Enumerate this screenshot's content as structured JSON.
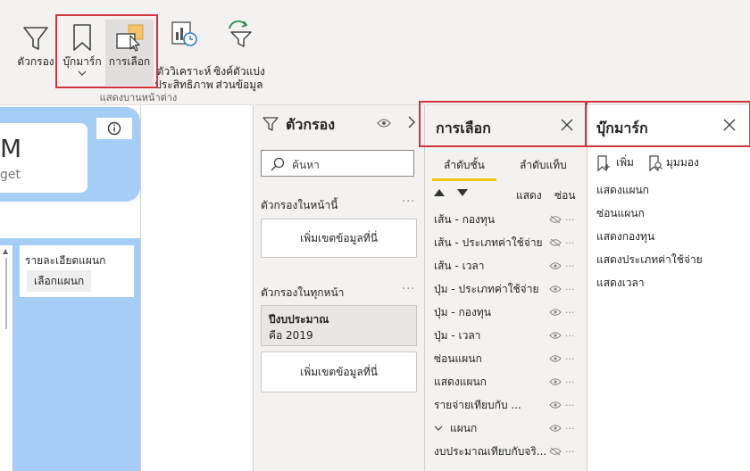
{
  "ribbon": {
    "buttons": [
      {
        "label": "ตัวกรอง",
        "icon": "filter-icon"
      },
      {
        "label": "บุ๊กมาร์ก",
        "icon": "bookmark-icon",
        "dropdown": "chevron-down-icon"
      },
      {
        "label": "การเลือก",
        "icon": "selection-icon"
      },
      {
        "label": "ตัววิเคราะห์\nประสิทธิภาพ",
        "icon": "performance-analyzer-icon"
      },
      {
        "label": "ซิงค์ตัวแบ่ง\nส่วนข้อมูล",
        "icon": "sync-slicers-icon"
      }
    ],
    "group_label": "แสดงบานหน้าต่าง",
    "highlight_color": "#d1343d"
  },
  "canvas": {
    "card_letter": "M",
    "card_subtext": "get",
    "info_icon": "info-icon",
    "detail_label": "รายละเอียดแผนก",
    "detail_button": "เลือกแผนก",
    "accent_color": "#a5cdf6"
  },
  "filters": {
    "title": "ตัวกรอง",
    "search_placeholder": "ค้นหา",
    "page_section": "ตัวกรองในหน้านี้",
    "page_well": "เพิ่มเขตข้อมูลที่นี่",
    "all_section": "ตัวกรองในทุกหน้า",
    "card_title": "ปีงบประมาณ",
    "card_value": "คือ 2019",
    "all_well": "เพิ่มเขตข้อมูลที่นี่"
  },
  "selection": {
    "title": "การเลือก",
    "tabs": [
      "ลำดับชั้น",
      "ลำดับแท็บ"
    ],
    "show_label": "แสดง",
    "hide_label": "ซ่อน",
    "items": [
      {
        "label": "เส้น - กองทุน",
        "visible": false
      },
      {
        "label": "เส้น - ประเภทค่าใช้จ่าย",
        "visible": false
      },
      {
        "label": "เส้น - เวลา",
        "visible": true
      },
      {
        "label": "ปุ่ม - ประเภทค่าใช้จ่าย",
        "visible": true
      },
      {
        "label": "ปุ่ม - กองทุน",
        "visible": true
      },
      {
        "label": "ปุ่ม - เวลา",
        "visible": true
      },
      {
        "label": "ซ่อนแผนก",
        "visible": true
      },
      {
        "label": "แสดงแผนก",
        "visible": true
      },
      {
        "label": "รายจ่ายเทียบกับ ...",
        "visible": true
      },
      {
        "label": "แผนก",
        "visible": true,
        "group": true
      },
      {
        "label": "งบประมาณเทียบกับจริ...",
        "visible": false
      }
    ],
    "accent_color": "#f2c811"
  },
  "bookmarks": {
    "title": "บุ๊กมาร์ก",
    "add_label": "เพิ่ม",
    "view_label": "มุมมอง",
    "items": [
      "แสดงแผนก",
      "ซ่อนแผนก",
      "แสดงกองทุน",
      "แสดงประเภทค่าใช้จ่าย",
      "แสดงเวลา"
    ]
  }
}
